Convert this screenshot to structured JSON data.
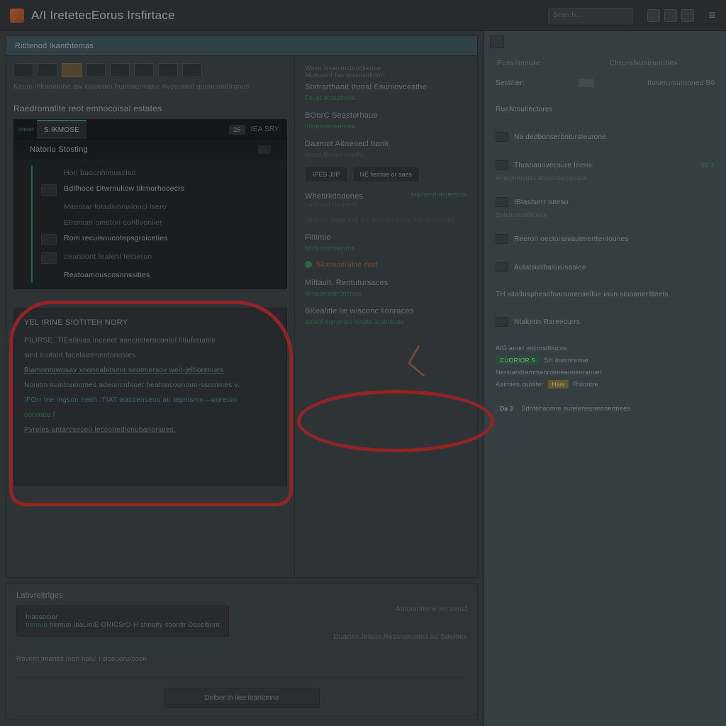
{
  "header": {
    "title": "A/I IretetecEorus Irsfirtace",
    "search_placeholder": "Search…"
  },
  "panel": {
    "title": "Ritltenod Ikanthtemas"
  },
  "main_left": {
    "desc1": "Keum ihkaemone aw ioceenet huntmormane Avcenmot aomusautironos",
    "desc2": "Wase issananctovoliertae",
    "desc3": "Mutnuont fao conunutlirerri",
    "section_title": "Raedromalite reot emnocoisal estates",
    "tab_active": "S.IKMOSE",
    "tab_badge": "26",
    "tab_suffix": "IEA SRY",
    "sub_row": "Natoriu Stosting",
    "items": [
      {
        "text": "Hon buocnhimusciso",
        "kind": "dim"
      },
      {
        "text": "Bdlfhoce Dtwrnuliow tilimorhocecrs",
        "kind": "hi",
        "icon": true
      },
      {
        "text": "Miteotar fotadivonwionci lsero",
        "kind": "dim"
      },
      {
        "text": "Etronom omstori cohfivoniier",
        "kind": "dim"
      },
      {
        "text": "Rom recuisnucotepsgroiceties",
        "kind": "hi",
        "icon": true
      },
      {
        "text": "Iteantiont fealenl fetoerun",
        "kind": "dim",
        "icon": true
      },
      {
        "text": "Reatoamouscosonssities",
        "kind": "hi"
      }
    ],
    "annot": {
      "title": "YEL IRINE SIOTITEH NORY",
      "lines": [
        {
          "t": "PILIRSE. TIEatinias inceeot aoncncterocontol litiuferumle",
          "cls": ""
        },
        {
          "t": "smit inotoirt focelaicenentonosies",
          "cls": ""
        },
        {
          "t": "Biamontowosay xnoneabitsent seotmersov weit-jeltiorenues",
          "cls": "u"
        },
        {
          "t": "Nonitm suintouoomes adeoncnfsoet heatonsounoun-ssommes v.",
          "cls": ""
        },
        {
          "t": "IFOrr tne ingson neith. TIAT waccenseos ati tepriismv—woreom",
          "cls": "link"
        },
        {
          "t": "coonato f",
          "cls": "grn"
        },
        {
          "t": "Pvreies antarcseceo lecconedlonubanoriaies.",
          "cls": "u"
        }
      ]
    }
  },
  "main_right": {
    "groups": [
      {
        "title": "Ststrarthanit threal Esuniovcesthe",
        "sub": "Fevat erosotrons"
      },
      {
        "title": "BOorC Seastorhaue",
        "sub": "Inionsvertenisies"
      },
      {
        "title": "Daamot Aitneoecl banit",
        "control": "buttons",
        "btns": [
          "IPES  JIIP",
          "NE fiectoe or saes"
        ],
        "caption": "imeet fltinioit warifvi"
      },
      {
        "title": "Whetirlidndenes",
        "right": "snommeracuencos",
        "lines": [
          "nacfiand bovisers",
          "Iommon loure och les wiotemirerlae lhtorecocerios"
        ]
      },
      {
        "title": "Flitimie",
        "sub": "kortintrotrcecens",
        "status": {
          "label": "Skanscelsilne east",
          "warn": true
        }
      },
      {
        "title": "Mittault. Rentutursaces",
        "sub": "inmaonsiieronsnon"
      },
      {
        "title": "BKealitle lie wisconc lionraces",
        "sub": "aoteilf oumones loneto aromsues"
      }
    ]
  },
  "bottom": {
    "title": "Labvreitriges",
    "card": {
      "l1": "Inassocier",
      "l2": "fremun IbaLiniE  ORICSrO-H shnaity sbontlr Daseltinnt"
    },
    "right_caption": "Antoninmme eo  sensf",
    "right_line": "Duartes.fesuin Ressiomomst iu/  Sdemes",
    "hint": "Roverri imenes mon nolu: i siceuerurcoen",
    "button": "Diriber in iiee ieantonne"
  },
  "sidebar": {
    "headers": [
      "Pussinnnore",
      "Chruralsunirantities"
    ],
    "rows": [
      {
        "label": "Sestitier:",
        "trail": "Itoserursuruoned B0",
        "badge": true
      },
      {
        "label": "RueNtoutiectores"
      },
      {
        "label": "Na dedbonserbotursteurone",
        "icon": true
      },
      {
        "label": "Thrananovecsure Iriens.",
        "icon": true,
        "green": "SE.1",
        "sub": "Anmonmoues enico tairoesase"
      },
      {
        "label": "IBtastserr Iuteso",
        "icon": true,
        "sub": "Solatovendlicries"
      },
      {
        "label": "Reeron oectoraniautmerttentounes",
        "icon": true
      },
      {
        "label": "Autatsuobasusisasiee",
        "icon": true
      },
      {
        "label": "TH sitallusphesnfoaronreniiellue inun sinoarieritteets"
      },
      {
        "label": "Ntaketin Rareecurrs",
        "icon": true
      }
    ],
    "status_block": {
      "line1": "AIG anurt micorstitiucos",
      "pill1": "CUORIOR S",
      "after1": "SH  itunmremar",
      "line2": "Nerstandrammanrdeneanoenranner",
      "line3": "Aaimien.cubliter",
      "pill2": "Hais",
      "after2": "Rsiontre",
      "foot_badge": "Da J",
      "foot": "Sdritehanone sureienesreronertriees"
    }
  }
}
